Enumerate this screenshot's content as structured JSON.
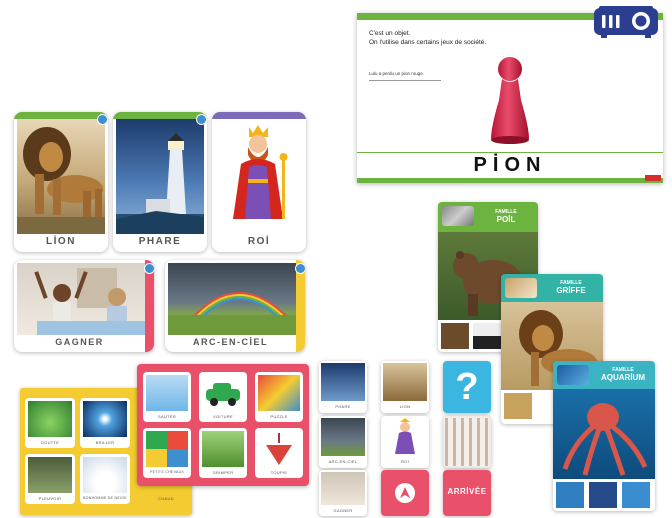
{
  "colors": {
    "green": "#6db33f",
    "blue": "#3d8fcf",
    "purple": "#7b6bb8",
    "pink": "#e9516b",
    "yellow": "#f4cc32",
    "teal": "#33b3a6",
    "projector": "#2c3e8f",
    "orange": "#f2a531"
  },
  "projector_slide": {
    "line1": "C'est un objet.",
    "line2": "On l'utilise dans certains jeux de société.",
    "bubble": "Lulu a perdu un pion rouge.",
    "word": "PİON",
    "icon": "projector-icon"
  },
  "word_cards": [
    {
      "word": "LİON"
    },
    {
      "word": "PHARE"
    },
    {
      "word": "ROİ"
    },
    {
      "word": "GAGNER"
    },
    {
      "word": "ARC-EN-CİEL"
    }
  ],
  "family_cards": [
    {
      "family": "FAMILLE",
      "name": "POİL"
    },
    {
      "family": "FAMILLE",
      "name": "GRİFFE"
    },
    {
      "family": "FAMILLE",
      "name": "AQUARİUM"
    }
  ],
  "game_board_left": {
    "cells": [
      "GOUTTE",
      "BRILLER",
      "PLEUVOIR",
      "BONHOMME DE NEIGE",
      "CHAUD"
    ]
  },
  "game_board_right": {
    "cells": [
      "SAUTER",
      "VOITURE",
      "PUZZLE",
      "PETITS CHEVAUX",
      "GRIMPER",
      "TOUPIE"
    ]
  },
  "small_cards": {
    "col1": [
      "PHARE",
      "ARC-EN-CİEL",
      "GAGNER"
    ],
    "col2": [
      "LİON",
      "ROİ"
    ],
    "question": "?",
    "arrival": "ARRİVÉE"
  }
}
